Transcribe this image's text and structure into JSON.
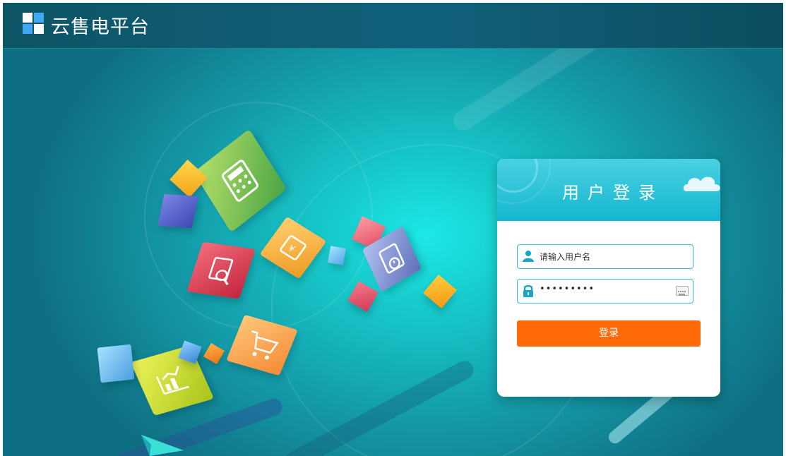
{
  "header": {
    "brand": "云售电平台"
  },
  "login": {
    "title": "用户登录",
    "username_placeholder": "请输入用户名",
    "password_masked": "•••••••••",
    "submit_label": "登录"
  },
  "colors": {
    "header_bg": "#10607a",
    "accent_cyan": "#15b6cf",
    "button_orange": "#fd6a07",
    "logo_blue": "#3fa9f5"
  },
  "icons": [
    "logo-icon",
    "user-icon",
    "lock-icon",
    "keyboard-icon",
    "cloud-icon",
    "calculator-icon",
    "wallet-icon",
    "search-document-icon",
    "clock-receipt-icon",
    "shopping-cart-icon",
    "chart-icon"
  ]
}
